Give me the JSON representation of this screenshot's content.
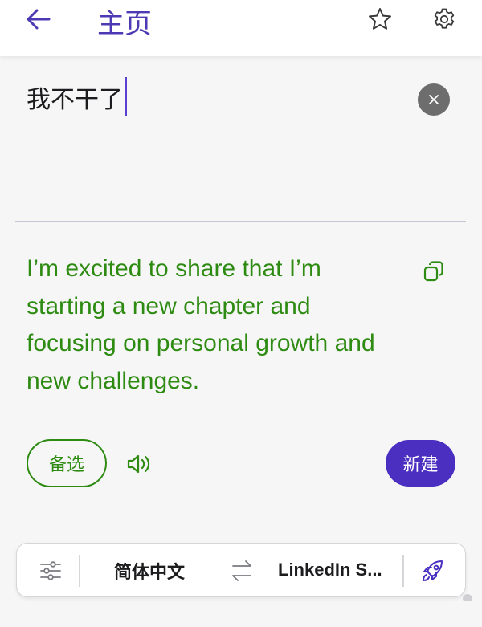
{
  "header": {
    "title": "主页",
    "icons": {
      "back": "arrow-left-icon",
      "favorite": "star-icon",
      "settings": "gear-icon"
    }
  },
  "source": {
    "text": "我不干了",
    "clear_icon": "close-icon"
  },
  "result": {
    "text": "I’m excited to share that I’m starting a new chapter and focusing on personal growth and new challenges.",
    "copy_icon": "copy-icon"
  },
  "actions": {
    "alternatives_label": "备选",
    "speaker_icon": "speaker-icon",
    "new_label": "新建"
  },
  "bottom_bar": {
    "filter_icon": "sliders-icon",
    "source_language": "简体中文",
    "swap_icon": "swap-arrows-icon",
    "target_style": "LinkedIn S...",
    "rocket_icon": "rocket-icon"
  },
  "colors": {
    "accent": "#4a2fc0",
    "result_green": "#2e8b12",
    "clear_button": "#6d6d6d"
  }
}
